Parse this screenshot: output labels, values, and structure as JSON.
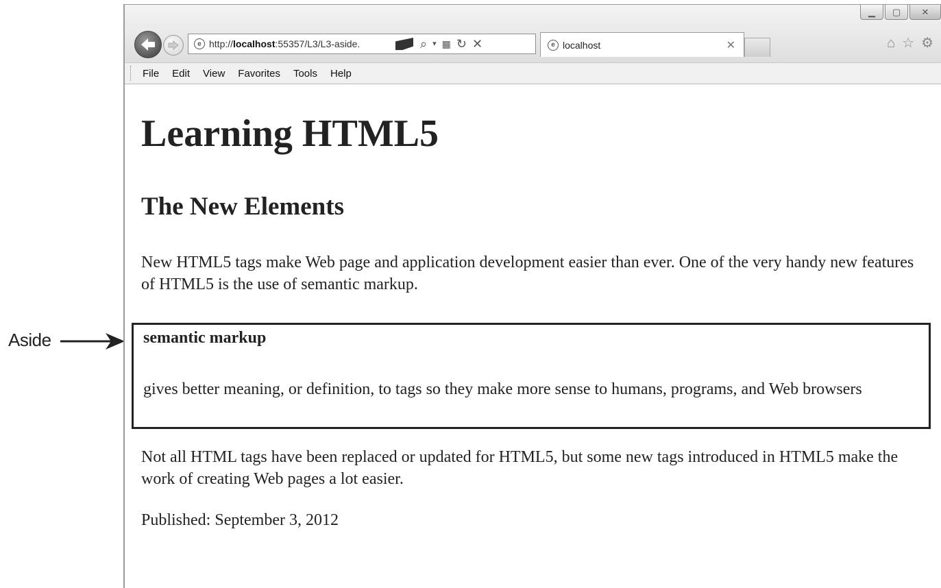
{
  "callout": {
    "label": "Aside"
  },
  "browser": {
    "address_prefix": "http://",
    "address_host": "localhost",
    "address_rest": ":55357/L3/L3-aside.",
    "tab_title": "localhost",
    "menu": [
      "File",
      "Edit",
      "View",
      "Favorites",
      "Tools",
      "Help"
    ],
    "icons": {
      "back": "back-arrow-icon",
      "forward": "forward-arrow-icon",
      "home": "home-icon",
      "favorites": "star-icon",
      "settings": "gear-icon"
    }
  },
  "page": {
    "title": "Learning HTML5",
    "subtitle": "The New Elements",
    "intro": "New HTML5 tags make Web page and application development easier than ever. One of the very handy new features of HTML5 is the use of semantic markup.",
    "aside": {
      "term": "semantic markup",
      "definition": "gives better meaning, or definition, to tags so they make more sense to humans, programs, and Web browsers"
    },
    "body": "Not all HTML tags have been replaced or updated for HTML5, but some new tags introduced in HTML5 make the work of creating Web pages a lot easier.",
    "published": "Published: September 3, 2012"
  }
}
